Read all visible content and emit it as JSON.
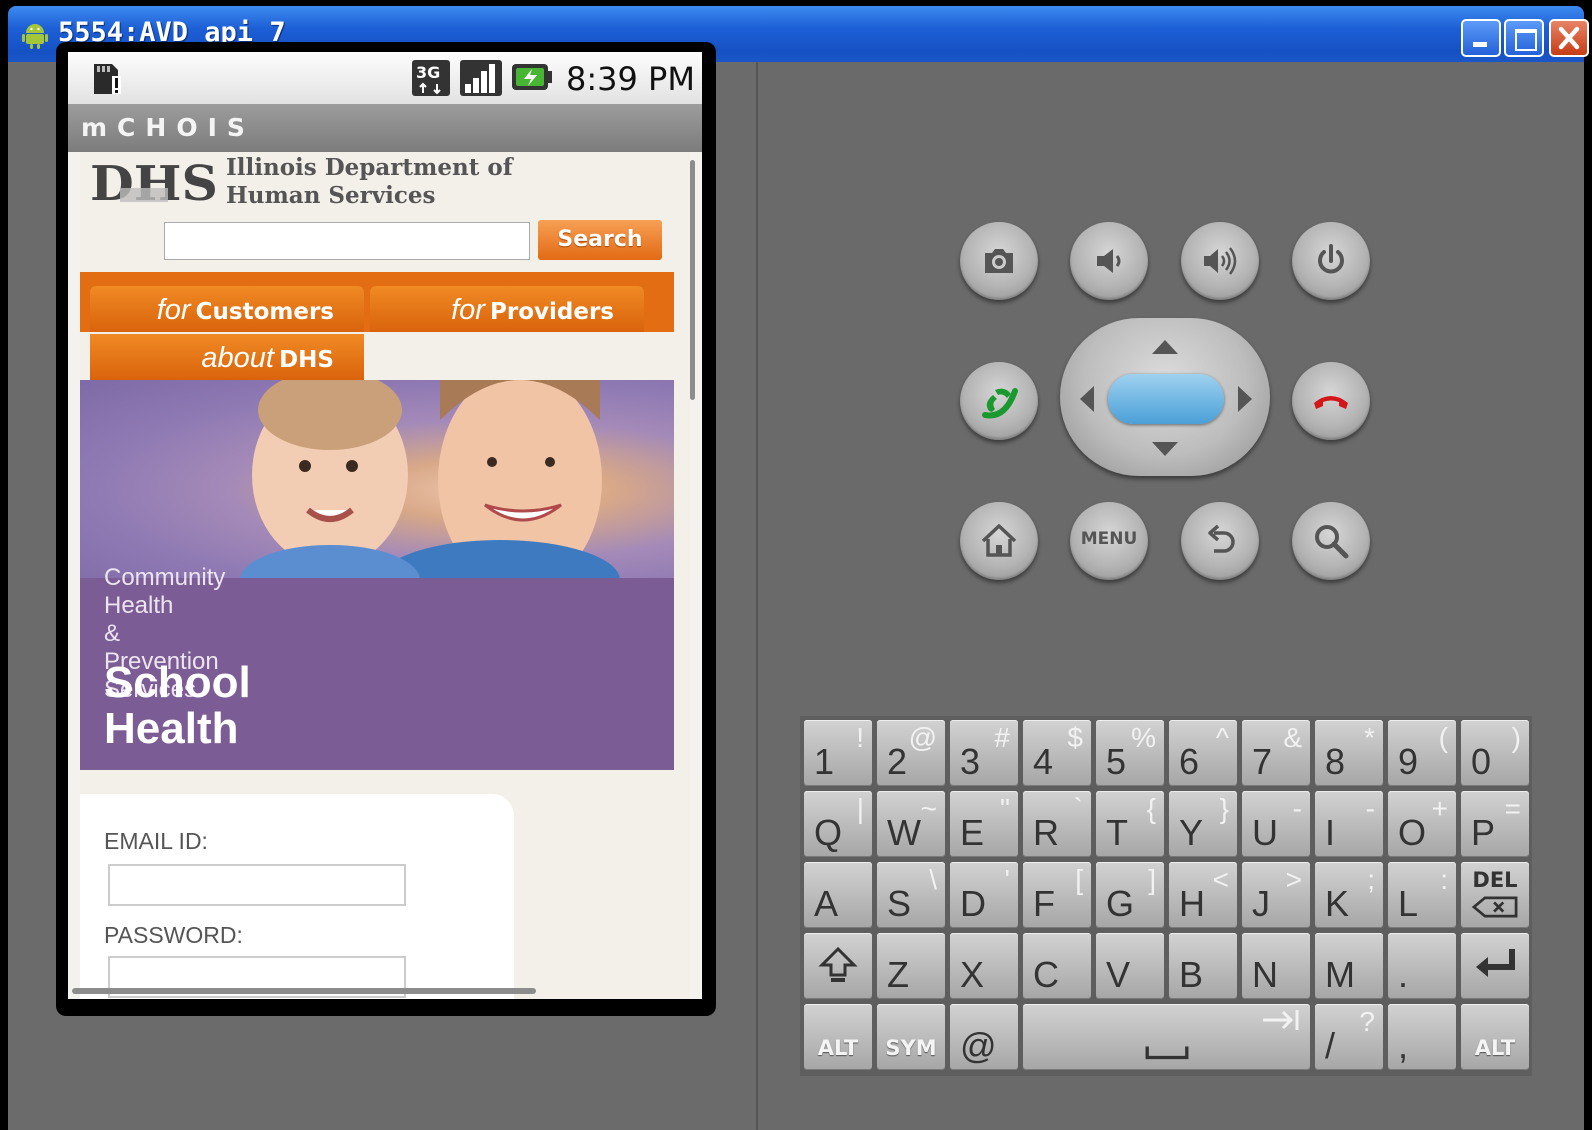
{
  "window": {
    "title": "5554:AVD_api_7"
  },
  "phone": {
    "status_bar": {
      "time": "8:39 PM",
      "icons": [
        "sd-card-warning-icon",
        "3g-icon",
        "signal-strength-icon",
        "battery-charging-icon"
      ]
    },
    "app_title": "mCHOIS",
    "webpage": {
      "logo_text": "DHS",
      "department": "Illinois Department of\nHuman Services",
      "search": {
        "value": "",
        "button_label": "Search"
      },
      "nav_tabs": [
        {
          "prefix": "for",
          "label": "Customers"
        },
        {
          "prefix": "for",
          "label": "Providers"
        },
        {
          "prefix": "about",
          "label": "DHS"
        }
      ],
      "section_label": "Community\nHealth\n&\nPrevention\nServices",
      "section_title": "School\nHealth",
      "login": {
        "email_label": "EMAIL ID:",
        "email_value": "",
        "password_label": "PASSWORD:",
        "password_value": ""
      }
    }
  },
  "emulator_controls": {
    "buttons": [
      "camera-icon",
      "volume-down-icon",
      "volume-up-icon",
      "power-icon",
      "call-icon",
      "end-call-icon",
      "home-icon",
      "menu",
      "back-icon",
      "search-icon"
    ],
    "menu_label": "MENU"
  },
  "keyboard": {
    "rows": [
      [
        [
          "1",
          "!"
        ],
        [
          "2",
          "@"
        ],
        [
          "3",
          "#"
        ],
        [
          "4",
          "$"
        ],
        [
          "5",
          "%"
        ],
        [
          "6",
          "^"
        ],
        [
          "7",
          "&"
        ],
        [
          "8",
          "*"
        ],
        [
          "9",
          "("
        ],
        [
          "0",
          ")"
        ]
      ],
      [
        [
          "Q",
          "|"
        ],
        [
          "W",
          "~"
        ],
        [
          "E",
          "\""
        ],
        [
          "R",
          "`"
        ],
        [
          "T",
          "{"
        ],
        [
          "Y",
          "}"
        ],
        [
          "U",
          "-"
        ],
        [
          "I",
          "-"
        ],
        [
          "O",
          "+"
        ],
        [
          "P",
          "="
        ]
      ],
      [
        [
          "A",
          ""
        ],
        [
          "S",
          "\\"
        ],
        [
          "D",
          "'"
        ],
        [
          "F",
          "["
        ],
        [
          "G",
          "]"
        ],
        [
          "H",
          "<"
        ],
        [
          "J",
          ">"
        ],
        [
          "K",
          ";"
        ],
        [
          "L",
          ":"
        ]
      ]
    ],
    "del_label": "DEL",
    "row4": [
      "Z",
      "X",
      "C",
      "V",
      "B",
      "N",
      "M",
      "."
    ],
    "alt_label": "ALT",
    "sym_label": "SYM",
    "at_label": "@",
    "slash": [
      "/",
      "?"
    ],
    "comma": ","
  }
}
